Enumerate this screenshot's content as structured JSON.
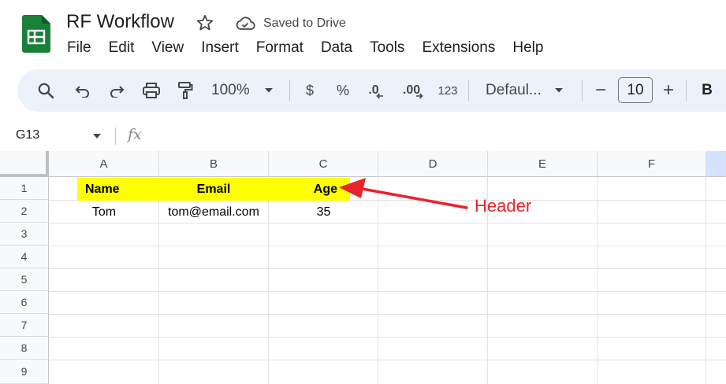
{
  "app": {
    "doc_title": "RF Workflow",
    "save_status": "Saved to Drive",
    "logo_color": "#188038"
  },
  "menu": {
    "items": [
      "File",
      "Edit",
      "View",
      "Insert",
      "Format",
      "Data",
      "Tools",
      "Extensions",
      "Help"
    ]
  },
  "toolbar": {
    "zoom": "100%",
    "currency_label": "$",
    "percent_label": "%",
    "decrease_decimal_label": ".0",
    "increase_decimal_label": ".00",
    "number_format_label": "123",
    "font_name": "Defaul...",
    "minus_label": "−",
    "font_size": "10",
    "plus_label": "+",
    "bold_label": "B",
    "icons": [
      "search-icon",
      "undo-icon",
      "redo-icon",
      "print-icon",
      "paint-format-icon"
    ]
  },
  "formula_bar": {
    "name_box": "G13",
    "fx_label": "fx",
    "formula": ""
  },
  "sheet": {
    "columns": [
      "A",
      "B",
      "C",
      "D",
      "E",
      "F"
    ],
    "rows": [
      "1",
      "2",
      "3",
      "4",
      "5",
      "6",
      "7",
      "8",
      "9"
    ],
    "header_row": [
      "Name",
      "Email",
      "Age"
    ],
    "data_row": [
      "Tom",
      "tom@email.com",
      "35"
    ],
    "header_fill": "#ffff00"
  },
  "annotation": {
    "label": "Header",
    "color": "#e8232a"
  }
}
